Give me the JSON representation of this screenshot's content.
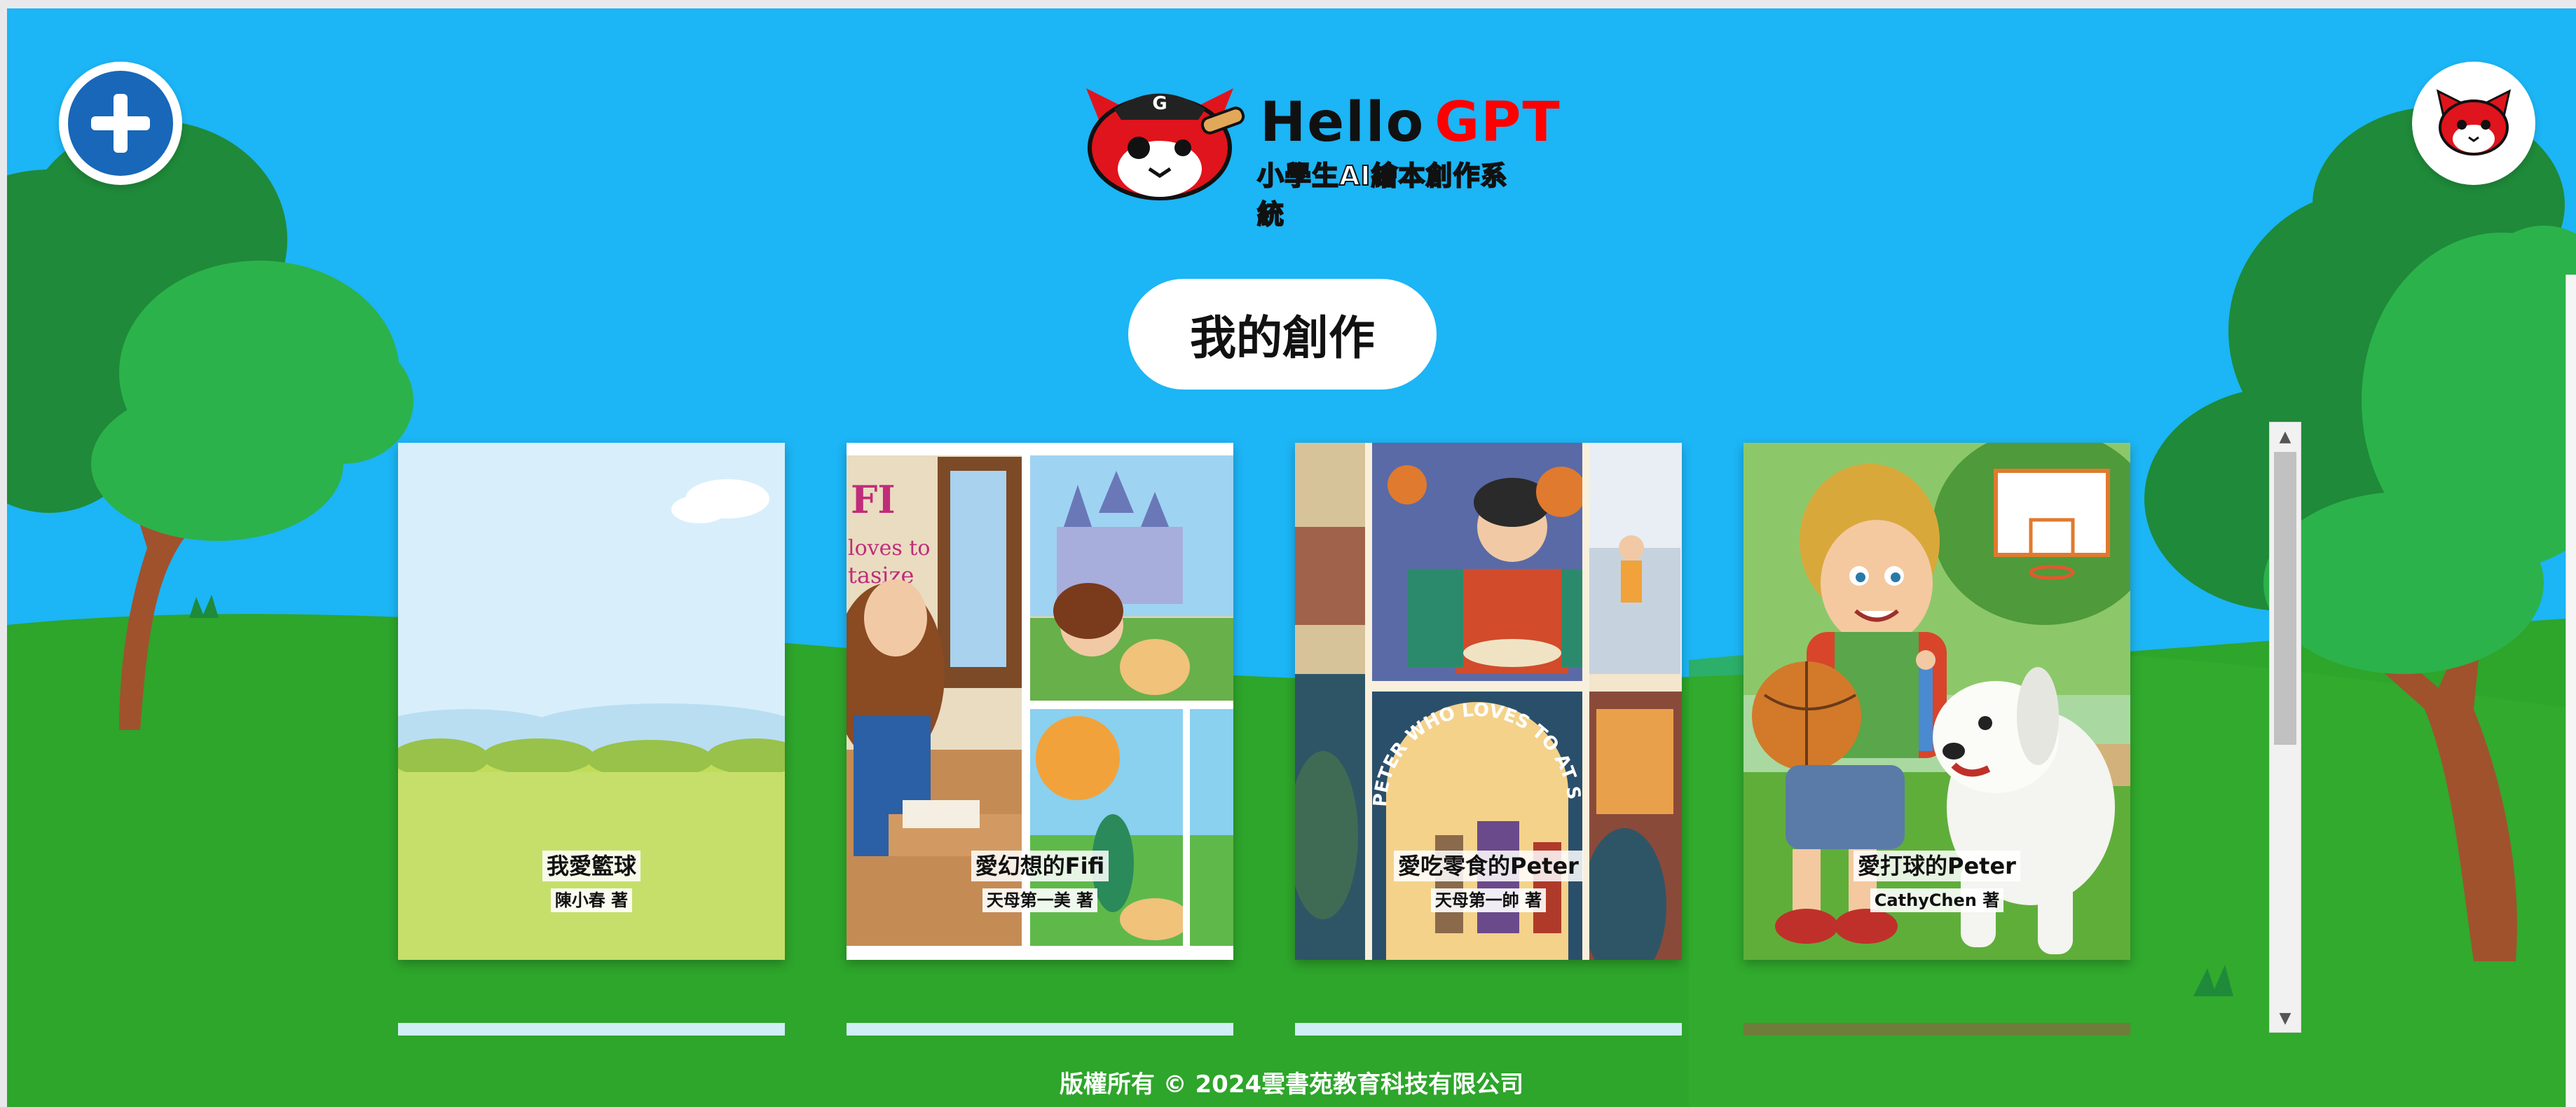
{
  "header": {
    "add_button_label": "+",
    "logo_title_hello": "Hello",
    "logo_title_gpt": "GPT",
    "logo_subtitle": "小學生AI繪本創作系統"
  },
  "main": {
    "page_title": "我的創作",
    "books": [
      {
        "title": "我愛籃球",
        "author": "陳小春 著"
      },
      {
        "title": "愛幻想的Fifi",
        "author": "天母第一美 著"
      },
      {
        "title": "愛吃零食的Peter",
        "author": "天母第一帥 著"
      },
      {
        "title": "愛打球的Peter",
        "author": "CathyChen 著"
      }
    ],
    "cover_texts": {
      "fifi_cover_fragment_1": "FI",
      "fifi_cover_fragment_2": "loves to",
      "fifi_cover_fragment_3": "tasize",
      "peter_snacks_arch": "PETER WHO LOVES TO AT SNACKS"
    }
  },
  "footer": {
    "copyright": "版權所有  ©  2024雲書苑教育科技有限公司"
  },
  "colors": {
    "sky": "#1cb5f5",
    "grass": "#2ea52b",
    "tree_dark": "#1f8a3a",
    "trunk": "#a0522d",
    "add_button": "#1867b9",
    "gpt_red": "#ff0000"
  },
  "icons": {
    "add": "plus-icon",
    "avatar": "red-cat-mascot-icon",
    "logo": "pirate-cat-logo"
  }
}
